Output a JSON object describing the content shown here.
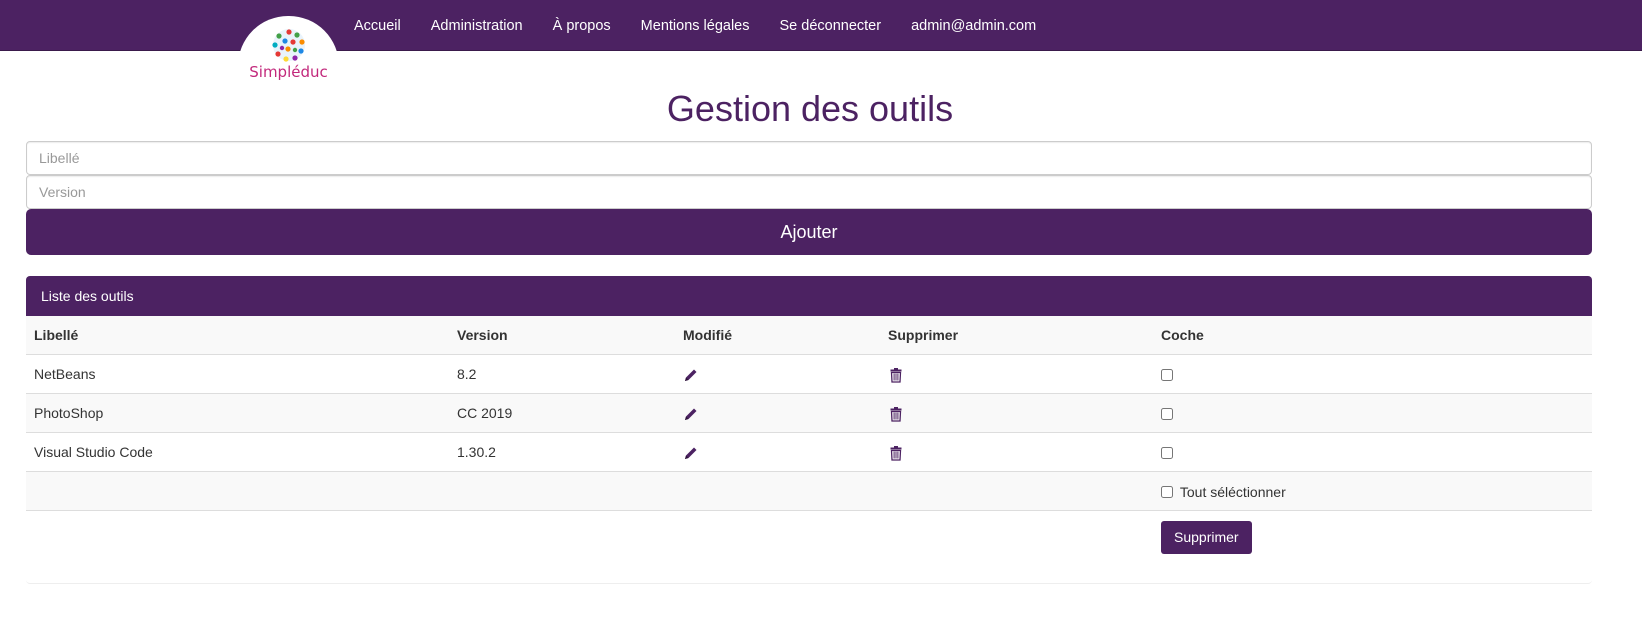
{
  "brand": {
    "logo_text": "Simpléduc",
    "accent_color": "#4c2262",
    "logo_color": "#c2287b",
    "logo_icon": "people-globe-icon"
  },
  "nav": {
    "items": [
      {
        "label": "Accueil"
      },
      {
        "label": "Administration"
      },
      {
        "label": "À propos"
      },
      {
        "label": "Mentions légales"
      },
      {
        "label": "Se déconnecter"
      },
      {
        "label": "admin@admin.com"
      }
    ]
  },
  "main": {
    "title": "Gestion des outils",
    "form": {
      "libelle_placeholder": "Libellé",
      "libelle_value": "",
      "version_placeholder": "Version",
      "version_value": "",
      "add_label": "Ajouter"
    },
    "panel": {
      "heading": "Liste des outils",
      "columns": [
        "Libellé",
        "Version",
        "Modifié",
        "Supprimer",
        "Coche"
      ],
      "rows": [
        {
          "libelle": "NetBeans",
          "version": "8.2",
          "edit_icon": "pencil-icon",
          "delete_icon": "trash-icon",
          "checked": false
        },
        {
          "libelle": "PhotoShop",
          "version": "CC 2019",
          "edit_icon": "pencil-icon",
          "delete_icon": "trash-icon",
          "checked": false
        },
        {
          "libelle": "Visual Studio Code",
          "version": "1.30.2",
          "edit_icon": "pencil-icon",
          "delete_icon": "trash-icon",
          "checked": false
        }
      ],
      "select_all_label": "Tout séléctionner",
      "delete_button_label": "Supprimer"
    }
  }
}
